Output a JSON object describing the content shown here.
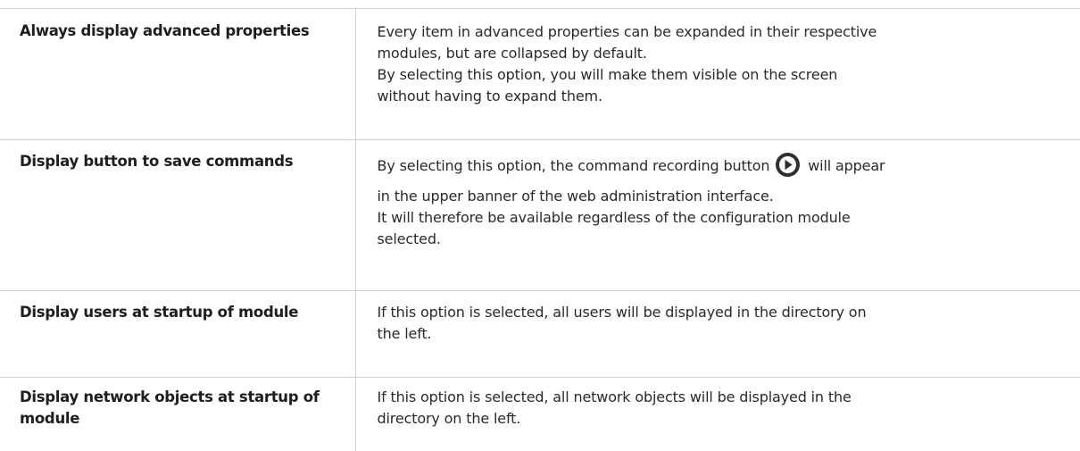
{
  "rows": [
    {
      "name": "Always display advanced properties",
      "description": [
        "Every item in advanced properties can be expanded in their respective",
        "modules, but are collapsed by default.",
        "By selecting this option, you will make them visible on the screen",
        "without having to expand them."
      ]
    },
    {
      "name": "Display button to save commands",
      "description_first_before_icon": "By selecting this option, the command recording button",
      "description_first_after_icon": "will appear",
      "icon": "record-play-icon",
      "description": [
        "in the upper banner of the web administration interface.",
        "It will therefore be available regardless of the configuration module",
        "selected."
      ]
    },
    {
      "name": "Display users at startup of module",
      "description": [
        "If this option is selected, all users will be displayed in the directory on",
        "the left."
      ]
    },
    {
      "name": "Display network objects at startup of module",
      "description": [
        "If this option is selected, all network objects will be displayed in the",
        "directory on the left."
      ]
    }
  ]
}
